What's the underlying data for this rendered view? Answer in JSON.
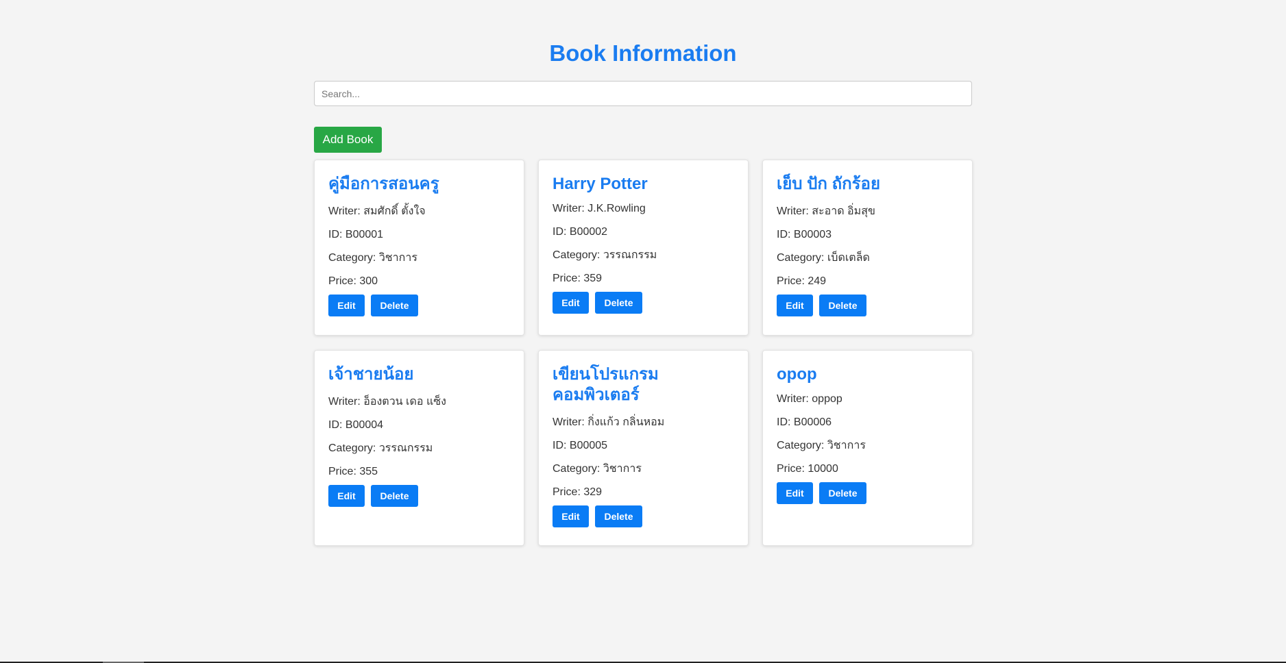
{
  "header": {
    "title": "Book Information"
  },
  "search": {
    "placeholder": "Search...",
    "value": ""
  },
  "toolbar": {
    "add_label": "Add Book"
  },
  "labels": {
    "writer": "Writer: ",
    "id": "ID: ",
    "category": "Category: ",
    "price": "Price: ",
    "edit": "Edit",
    "delete": "Delete"
  },
  "books": [
    {
      "title": "คู่มือการสอนครู",
      "writer": "สมศักดิ์ ตั้งใจ",
      "id": "B00001",
      "category": "วิชาการ",
      "price": "300"
    },
    {
      "title": "Harry Potter",
      "writer": "J.K.Rowling",
      "id": "B00002",
      "category": "วรรณกรรม",
      "price": "359"
    },
    {
      "title": "เย็บ ปัก ถักร้อย",
      "writer": "สะอาด อิ่มสุข",
      "id": "B00003",
      "category": "เบ็ดเตล็ด",
      "price": "249"
    },
    {
      "title": "เจ้าชายน้อย",
      "writer": "อ็องตวน เดอ แซ็ง",
      "id": "B00004",
      "category": "วรรณกรรม",
      "price": "355"
    },
    {
      "title": "เขียนโปรแกรม คอมพิวเตอร์",
      "writer": "กิ่งแก้ว กลิ่นหอม",
      "id": "B00005",
      "category": "วิชาการ",
      "price": "329"
    },
    {
      "title": "opop",
      "writer": "oppop",
      "id": "B00006",
      "category": "วิชาการ",
      "price": "10000"
    }
  ],
  "colors": {
    "accent": "#1a7cf0",
    "add_button": "#28a745",
    "action_button": "#0a7cf5",
    "background": "#f4f4f4"
  }
}
